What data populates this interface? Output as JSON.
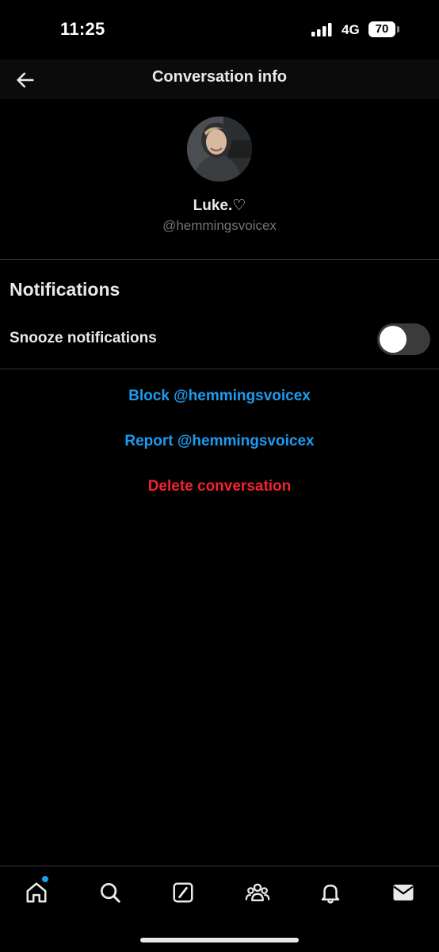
{
  "status_bar": {
    "time": "11:25",
    "network": "4G",
    "battery": "70"
  },
  "header": {
    "title": "Conversation info",
    "back_icon": "arrow-left-icon"
  },
  "profile": {
    "display_name": "Luke.♡",
    "handle": "@hemmingsvoicex"
  },
  "notifications": {
    "heading": "Notifications",
    "snooze_label": "Snooze notifications",
    "snooze_enabled": false
  },
  "actions": {
    "block": "Block @hemmingsvoicex",
    "report": "Report @hemmingsvoicex",
    "delete": "Delete conversation"
  },
  "colors": {
    "accent": "#1d9bf0",
    "danger": "#f4212e",
    "background": "#000000",
    "secondary_text": "#71767b"
  },
  "bottom_nav": {
    "items": [
      "home-icon",
      "search-icon",
      "grok-icon",
      "communities-icon",
      "notifications-bell-icon",
      "messages-mail-icon"
    ],
    "home_has_unread_dot": true
  }
}
